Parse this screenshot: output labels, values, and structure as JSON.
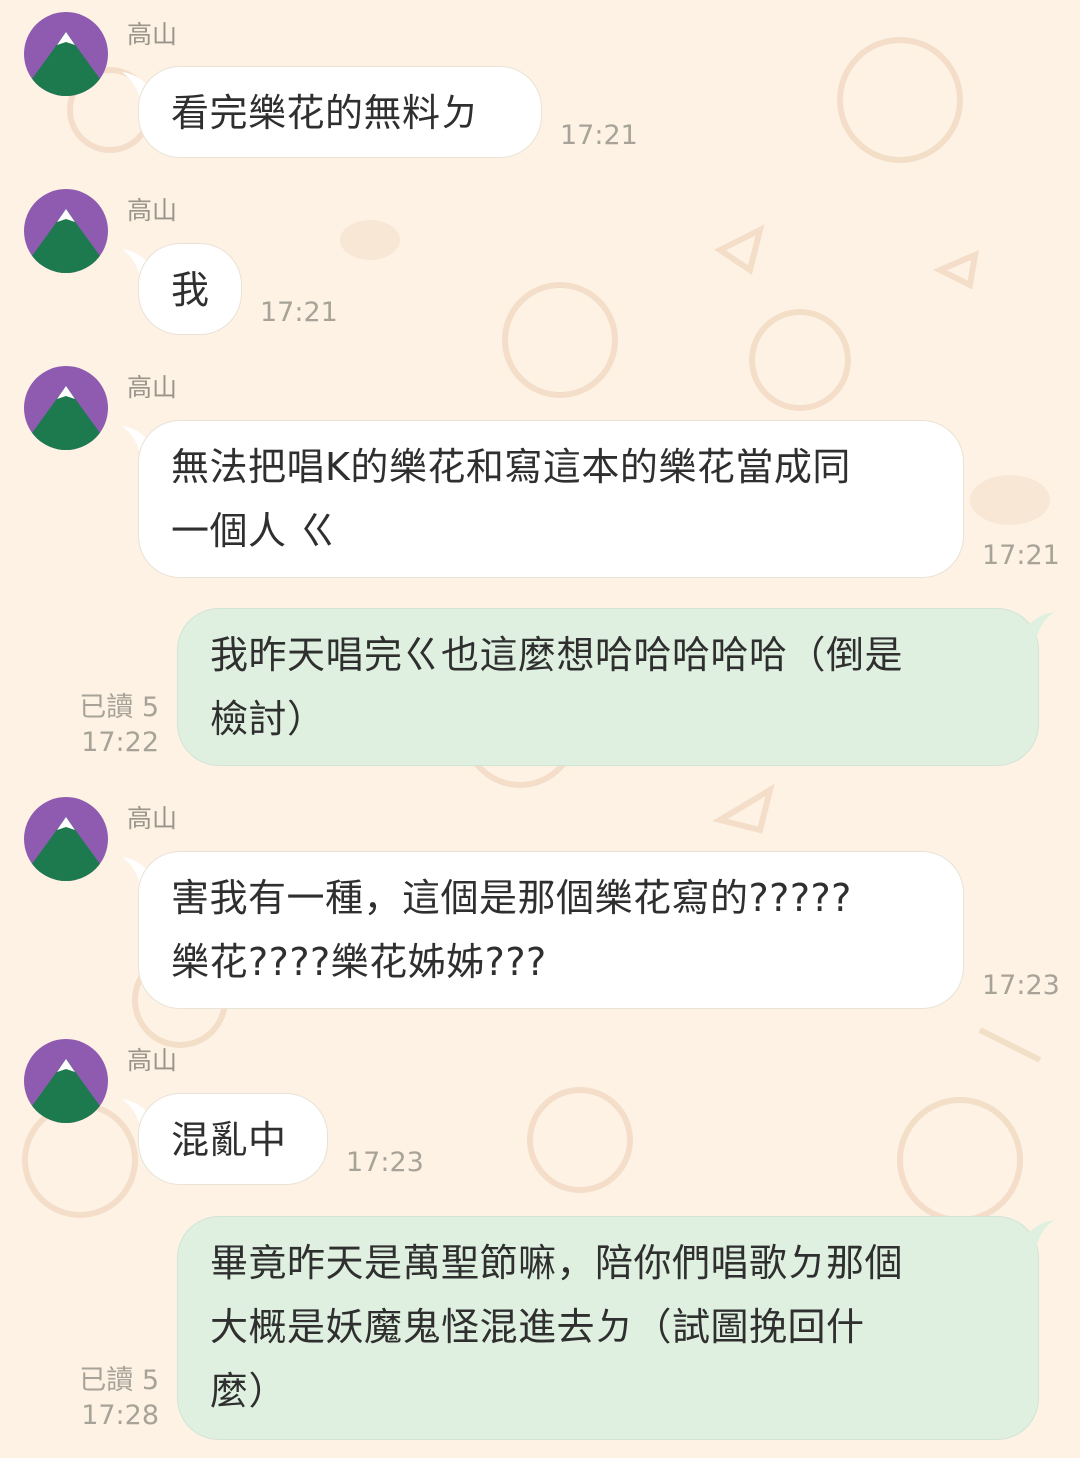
{
  "avatar": {
    "icon": "mountain-avatar-icon",
    "bg_color": "#8e5bb0",
    "mountain_color": "#1d7a4e",
    "snow_color": "#ffffff"
  },
  "colors": {
    "background": "#fdf2e4",
    "incoming_bubble": "#ffffff",
    "outgoing_bubble": "#dff0e0",
    "meta_text": "#a8a398"
  },
  "messages": [
    {
      "direction": "incoming",
      "sender": "高山",
      "lines": [
        "看完樂花的無料ㄉ"
      ],
      "time": "17:21"
    },
    {
      "direction": "incoming",
      "sender": "高山",
      "lines": [
        "我"
      ],
      "time": "17:21"
    },
    {
      "direction": "incoming",
      "sender": "高山",
      "lines": [
        "無法把唱K的樂花和寫這本的樂花當成同",
        "一個人 ㄍ"
      ],
      "time": "17:21"
    },
    {
      "direction": "outgoing",
      "read": "已讀 5",
      "lines": [
        "我昨天唱完ㄍ也這麼想哈哈哈哈哈（倒是",
        "檢討）"
      ],
      "time": "17:22"
    },
    {
      "direction": "incoming",
      "sender": "高山",
      "lines": [
        "害我有一種，這個是那個樂花寫的?????",
        "樂花????樂花姊姊???"
      ],
      "time": "17:23"
    },
    {
      "direction": "incoming",
      "sender": "高山",
      "lines": [
        "混亂中"
      ],
      "time": "17:23"
    },
    {
      "direction": "outgoing",
      "read": "已讀 5",
      "lines": [
        "畢竟昨天是萬聖節嘛，陪你們唱歌ㄉ那個",
        "大概是妖魔鬼怪混進去ㄉ（試圖挽回什",
        "麼）"
      ],
      "time": "17:28"
    }
  ]
}
